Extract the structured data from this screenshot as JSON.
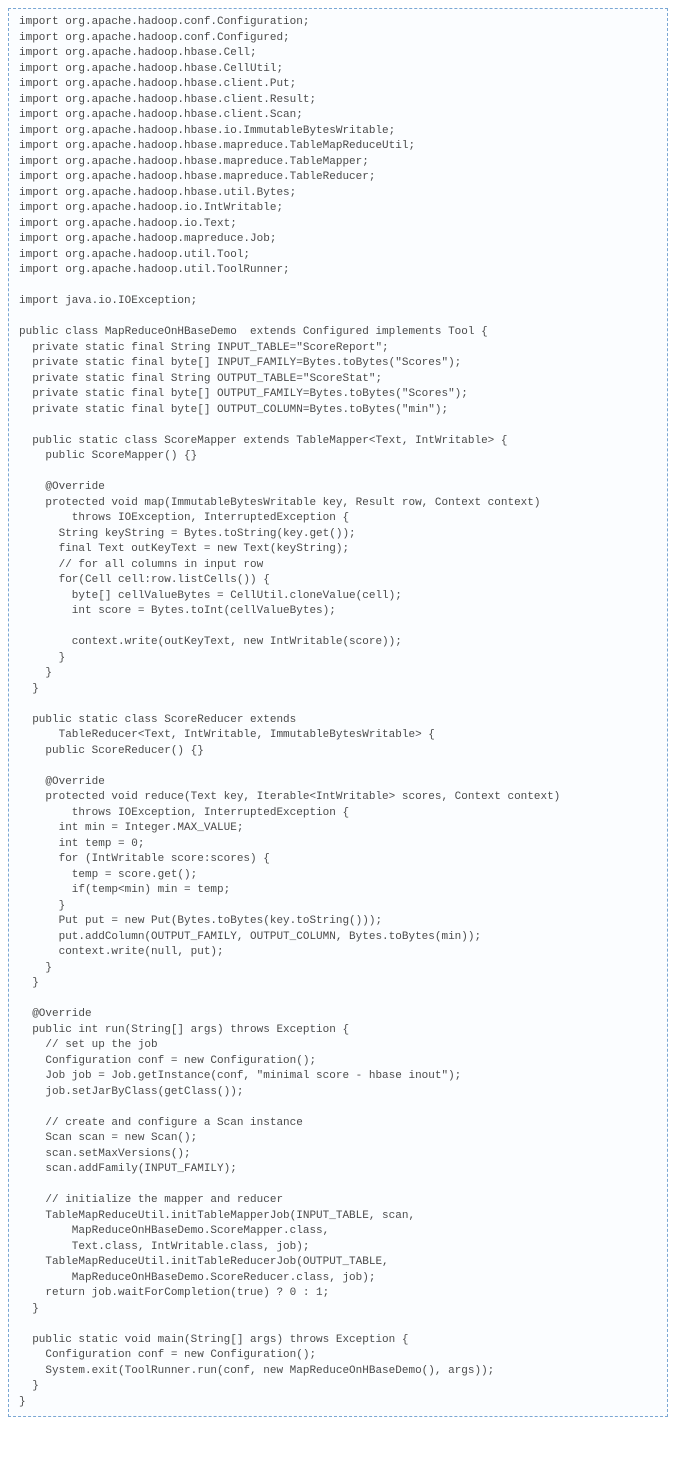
{
  "code": "import org.apache.hadoop.conf.Configuration;\nimport org.apache.hadoop.conf.Configured;\nimport org.apache.hadoop.hbase.Cell;\nimport org.apache.hadoop.hbase.CellUtil;\nimport org.apache.hadoop.hbase.client.Put;\nimport org.apache.hadoop.hbase.client.Result;\nimport org.apache.hadoop.hbase.client.Scan;\nimport org.apache.hadoop.hbase.io.ImmutableBytesWritable;\nimport org.apache.hadoop.hbase.mapreduce.TableMapReduceUtil;\nimport org.apache.hadoop.hbase.mapreduce.TableMapper;\nimport org.apache.hadoop.hbase.mapreduce.TableReducer;\nimport org.apache.hadoop.hbase.util.Bytes;\nimport org.apache.hadoop.io.IntWritable;\nimport org.apache.hadoop.io.Text;\nimport org.apache.hadoop.mapreduce.Job;\nimport org.apache.hadoop.util.Tool;\nimport org.apache.hadoop.util.ToolRunner;\n\nimport java.io.IOException;\n\npublic class MapReduceOnHBaseDemo  extends Configured implements Tool {\n  private static final String INPUT_TABLE=\"ScoreReport\";\n  private static final byte[] INPUT_FAMILY=Bytes.toBytes(\"Scores\");\n  private static final String OUTPUT_TABLE=\"ScoreStat\";\n  private static final byte[] OUTPUT_FAMILY=Bytes.toBytes(\"Scores\");\n  private static final byte[] OUTPUT_COLUMN=Bytes.toBytes(\"min\");\n\n  public static class ScoreMapper extends TableMapper<Text, IntWritable> {\n    public ScoreMapper() {}\n\n    @Override\n    protected void map(ImmutableBytesWritable key, Result row, Context context)\n        throws IOException, InterruptedException {\n      String keyString = Bytes.toString(key.get());\n      final Text outKeyText = new Text(keyString);\n      // for all columns in input row\n      for(Cell cell:row.listCells()) {\n        byte[] cellValueBytes = CellUtil.cloneValue(cell);\n        int score = Bytes.toInt(cellValueBytes);\n\n        context.write(outKeyText, new IntWritable(score));\n      }\n    }\n  }\n\n  public static class ScoreReducer extends\n      TableReducer<Text, IntWritable, ImmutableBytesWritable> {\n    public ScoreReducer() {}\n\n    @Override\n    protected void reduce(Text key, Iterable<IntWritable> scores, Context context)\n        throws IOException, InterruptedException {\n      int min = Integer.MAX_VALUE;\n      int temp = 0;\n      for (IntWritable score:scores) {\n        temp = score.get();\n        if(temp<min) min = temp;\n      }\n      Put put = new Put(Bytes.toBytes(key.toString()));\n      put.addColumn(OUTPUT_FAMILY, OUTPUT_COLUMN, Bytes.toBytes(min));\n      context.write(null, put);\n    }\n  }\n\n  @Override\n  public int run(String[] args) throws Exception {\n    // set up the job\n    Configuration conf = new Configuration();\n    Job job = Job.getInstance(conf, \"minimal score - hbase inout\");\n    job.setJarByClass(getClass());\n\n    // create and configure a Scan instance\n    Scan scan = new Scan();\n    scan.setMaxVersions();\n    scan.addFamily(INPUT_FAMILY);\n\n    // initialize the mapper and reducer\n    TableMapReduceUtil.initTableMapperJob(INPUT_TABLE, scan,\n        MapReduceOnHBaseDemo.ScoreMapper.class,\n        Text.class, IntWritable.class, job);\n    TableMapReduceUtil.initTableReducerJob(OUTPUT_TABLE,\n        MapReduceOnHBaseDemo.ScoreReducer.class, job);\n    return job.waitForCompletion(true) ? 0 : 1;\n  }\n\n  public static void main(String[] args) throws Exception {\n    Configuration conf = new Configuration();\n    System.exit(ToolRunner.run(conf, new MapReduceOnHBaseDemo(), args));\n  }\n}"
}
